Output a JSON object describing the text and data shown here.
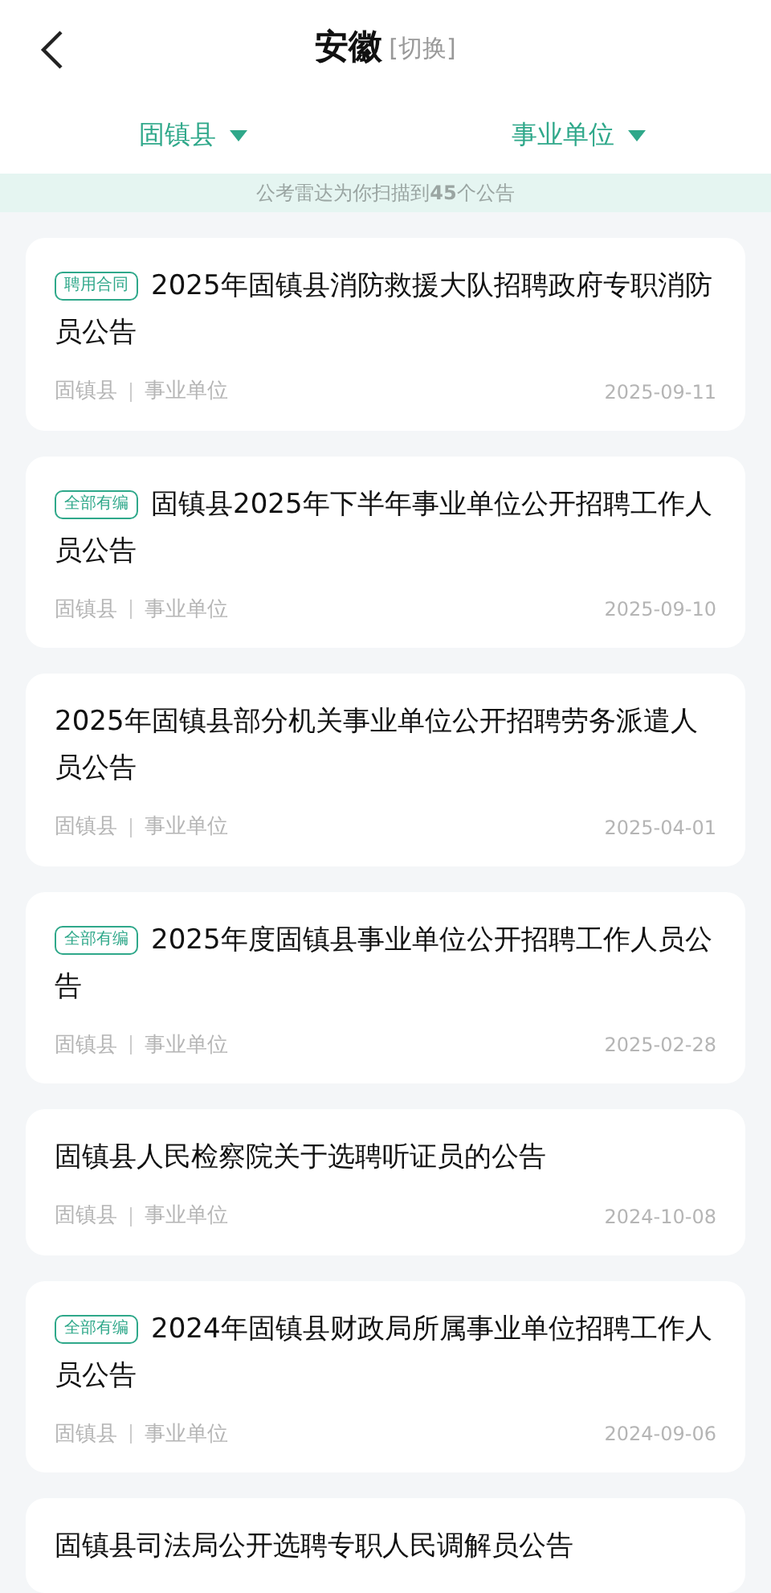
{
  "header": {
    "title": "安徽",
    "switch_label": "[切换]"
  },
  "filters": [
    {
      "label": "固镇县"
    },
    {
      "label": "事业单位"
    }
  ],
  "banner": {
    "text": "公考雷达为你扫描到**45**个公告"
  },
  "announcements": [
    {
      "tag": "聘用合同",
      "title": "2025年固镇县消防救援大队招聘政府专职消防员公告",
      "region": "固镇县",
      "type": "事业单位",
      "date": "2025-09-11"
    },
    {
      "tag": "全部有编",
      "title": "固镇县2025年下半年事业单位公开招聘工作人员公告",
      "region": "固镇县",
      "type": "事业单位",
      "date": "2025-09-10"
    },
    {
      "title": "2025年固镇县部分机关事业单位公开招聘劳务派遣人员公告",
      "region": "固镇县",
      "type": "事业单位",
      "date": "2025-04-01"
    },
    {
      "tag": "全部有编",
      "title": "2025年度固镇县事业单位公开招聘工作人员公告",
      "region": "固镇县",
      "type": "事业单位",
      "date": "2025-02-28"
    },
    {
      "title": "固镇县人民检察院关于选聘听证员的公告",
      "region": "固镇县",
      "type": "事业单位",
      "date": "2024-10-08"
    },
    {
      "tag": "全部有编",
      "title": "2024年固镇县财政局所属事业单位招聘工作人员公告",
      "region": "固镇县",
      "type": "事业单位",
      "date": "2024-09-06"
    },
    {
      "title": "固镇县司法局公开选聘专职人民调解员公告"
    }
  ]
}
